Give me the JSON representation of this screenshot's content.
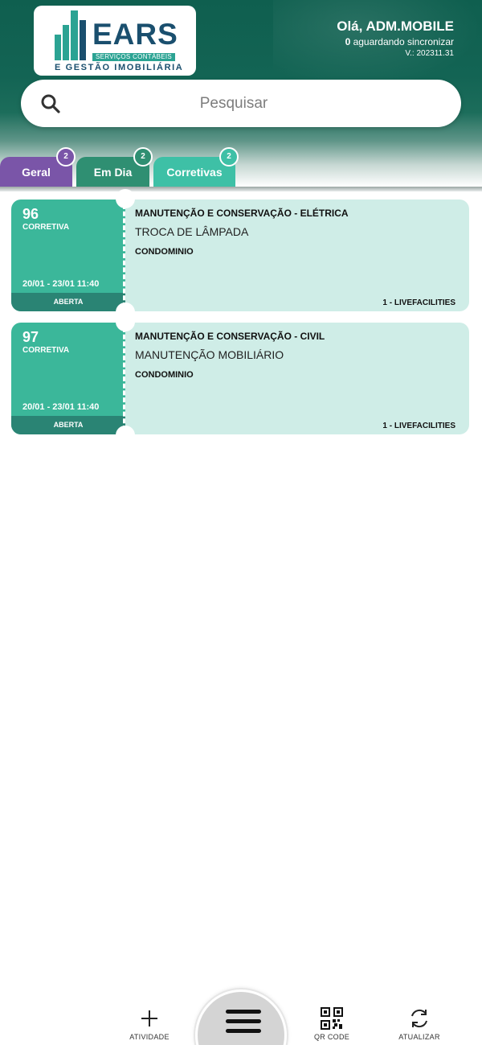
{
  "header": {
    "logo": {
      "brand": "EARS",
      "strip": "SERVIÇOS CONTÁBEIS",
      "subtitle": "E GESTÃO IMOBILIÁRIA"
    },
    "greeting": "Olá, ADM.MOBILE",
    "sync_count": "0",
    "sync_text": " aguardando sincronizar",
    "version": "V.: 202311.31",
    "colors": {
      "primary": "#136454",
      "accent": "#3bb79a"
    }
  },
  "search": {
    "placeholder": "Pesquisar",
    "icon": "search-icon"
  },
  "tabs": [
    {
      "label": "Geral",
      "count": "2",
      "color": "#7a55a8"
    },
    {
      "label": "Em Dia",
      "count": "2",
      "color": "#2f8f72"
    },
    {
      "label": "Corretivas",
      "count": "2",
      "color": "#3ec0a6"
    }
  ],
  "cards": [
    {
      "number": "96",
      "type": "CORRETIVA",
      "date": "20/01 - 23/01 11:40",
      "status": "ABERTA",
      "category": "MANUTENÇÃO E CONSERVAÇÃO - ELÉTRICA",
      "task": "TROCA DE LÂMPADA",
      "location": "CONDOMINIO",
      "responsible": "1 - LIVEFACILITIES"
    },
    {
      "number": "97",
      "type": "CORRETIVA",
      "date": "20/01 - 23/01 11:40",
      "status": "ABERTA",
      "category": "MANUTENÇÃO E CONSERVAÇÃO - CIVIL",
      "task": "MANUTENÇÃO MOBILIÁRIO",
      "location": "CONDOMINIO",
      "responsible": "1 - LIVEFACILITIES"
    }
  ],
  "bottom_nav": {
    "atividade": {
      "label": "ATIVIDADE",
      "icon": "plus-icon"
    },
    "menu": {
      "icon": "hamburger-menu-icon"
    },
    "qr": {
      "label": "QR CODE",
      "icon": "qr-code-icon"
    },
    "atualizar": {
      "label": "ATUALIZAR",
      "icon": "refresh-icon"
    }
  }
}
